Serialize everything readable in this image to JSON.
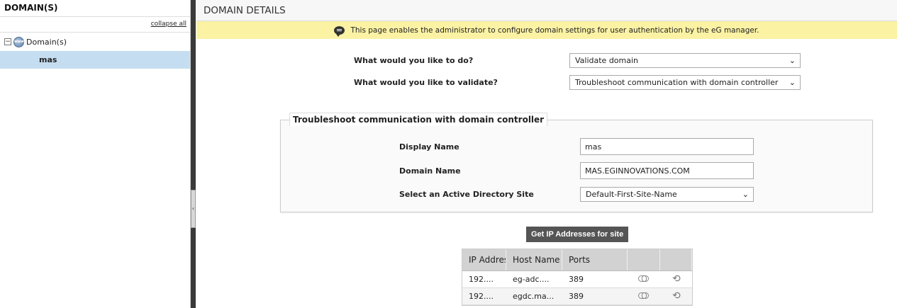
{
  "sidebar": {
    "title": "DOMAIN(S)",
    "collapse_all": "collapse all",
    "root_label": "Domain(s)",
    "root_toggle": "−",
    "children": [
      {
        "label": "mas",
        "selected": true
      }
    ]
  },
  "splitter": {
    "handle_glyph": "‹"
  },
  "main": {
    "title": "DOMAIN DETAILS",
    "info": "This page enables the administrator to configure domain settings for user authentication by the eG manager.",
    "action_label": "What would you like to do?",
    "action_value": "Validate domain",
    "validate_label": "What would you like to validate?",
    "validate_value": "Troubleshoot communication with domain controller"
  },
  "form": {
    "legend": "Troubleshoot communication with domain controller",
    "display_name_label": "Display Name",
    "display_name_value": "mas",
    "domain_name_label": "Domain Name",
    "domain_name_value": "MAS.EGINNOVATIONS.COM",
    "ad_site_label": "Select an Active Directory Site",
    "ad_site_value": "Default-First-Site-Name",
    "get_ip_button": "Get IP Addresses for site"
  },
  "table": {
    "headers": [
      "IP Address",
      "Host Name",
      "Ports",
      "",
      ""
    ],
    "rows": [
      {
        "ip": "192....",
        "host": "eg-adc....",
        "port": "389"
      },
      {
        "ip": "192....",
        "host": "egdc.ma...",
        "port": "389"
      }
    ]
  },
  "icons": {
    "chevron": "chevron-down-icon",
    "globe": "globe-icon",
    "bubble": "speech-bubble-icon",
    "link": "link-icon",
    "refresh": "refresh-icon"
  }
}
